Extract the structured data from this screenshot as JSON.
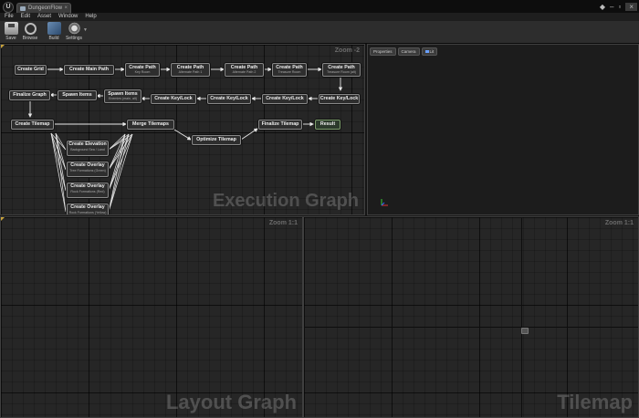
{
  "window": {
    "tab_title": "DungeonFlow",
    "logo_text": "U"
  },
  "menu": [
    "File",
    "Edit",
    "Asset",
    "Window",
    "Help"
  ],
  "toolbar": {
    "save": "Save",
    "browse": "Browse",
    "build": "Build",
    "settings": "Settings"
  },
  "execution_graph": {
    "zoom": "Zoom -2",
    "watermark": "Execution Graph",
    "nodes": {
      "create_grid": "Create Grid",
      "create_main_path": "Create Main Path",
      "create_path_1": "Create Path",
      "create_path_1_sub": "Key Room",
      "create_path_2": "Create Path",
      "create_path_2_sub": "Alternate Path 1",
      "create_path_3": "Create Path",
      "create_path_3_sub": "Alternate Path 2",
      "create_path_4": "Create Path",
      "create_path_4_sub": "Treasure Room",
      "create_path_5": "Create Path",
      "create_path_5_sub": "Treasure Room (alt)",
      "create_key_lock_1": "Create Key/Lock",
      "create_key_lock_2": "Create Key/Lock",
      "create_key_lock_3": "Create Key/Lock",
      "create_key_lock_4": "Create Key/Lock",
      "spawn_items_1": "Spawn Items",
      "spawn_items_1_sub": "Enemies (main, alt)",
      "spawn_items_2": "Spawn Items",
      "finalize_graph": "Finalize Graph",
      "create_tilemap": "Create Tilemap",
      "merge_tilemaps": "Merge Tilemaps",
      "optimize_tilemap": "Optimize Tilemap",
      "finalize_tilemap": "Finalize Tilemap",
      "result": "Result",
      "create_elevation": "Create Elevation",
      "create_elevation_sub": "Background Sea / Land",
      "create_overlay_1": "Create Overlay",
      "create_overlay_1_sub": "Tree Formations (Green)",
      "create_overlay_2": "Create Overlay",
      "create_overlay_2_sub": "Rock Formations (Red)",
      "create_overlay_3": "Create Overlay",
      "create_overlay_3_sub": "Rock Formations (Yellow)"
    }
  },
  "viewport": {
    "tabs": [
      "Properties",
      "Camera",
      "Lit"
    ]
  },
  "layout_graph": {
    "zoom": "Zoom 1:1",
    "watermark": "Layout Graph"
  },
  "tilemap": {
    "zoom": "Zoom 1:1",
    "watermark": "Tilemap"
  },
  "colors": {
    "accent": "#c8a23a",
    "result_border": "#7c9c6c"
  }
}
